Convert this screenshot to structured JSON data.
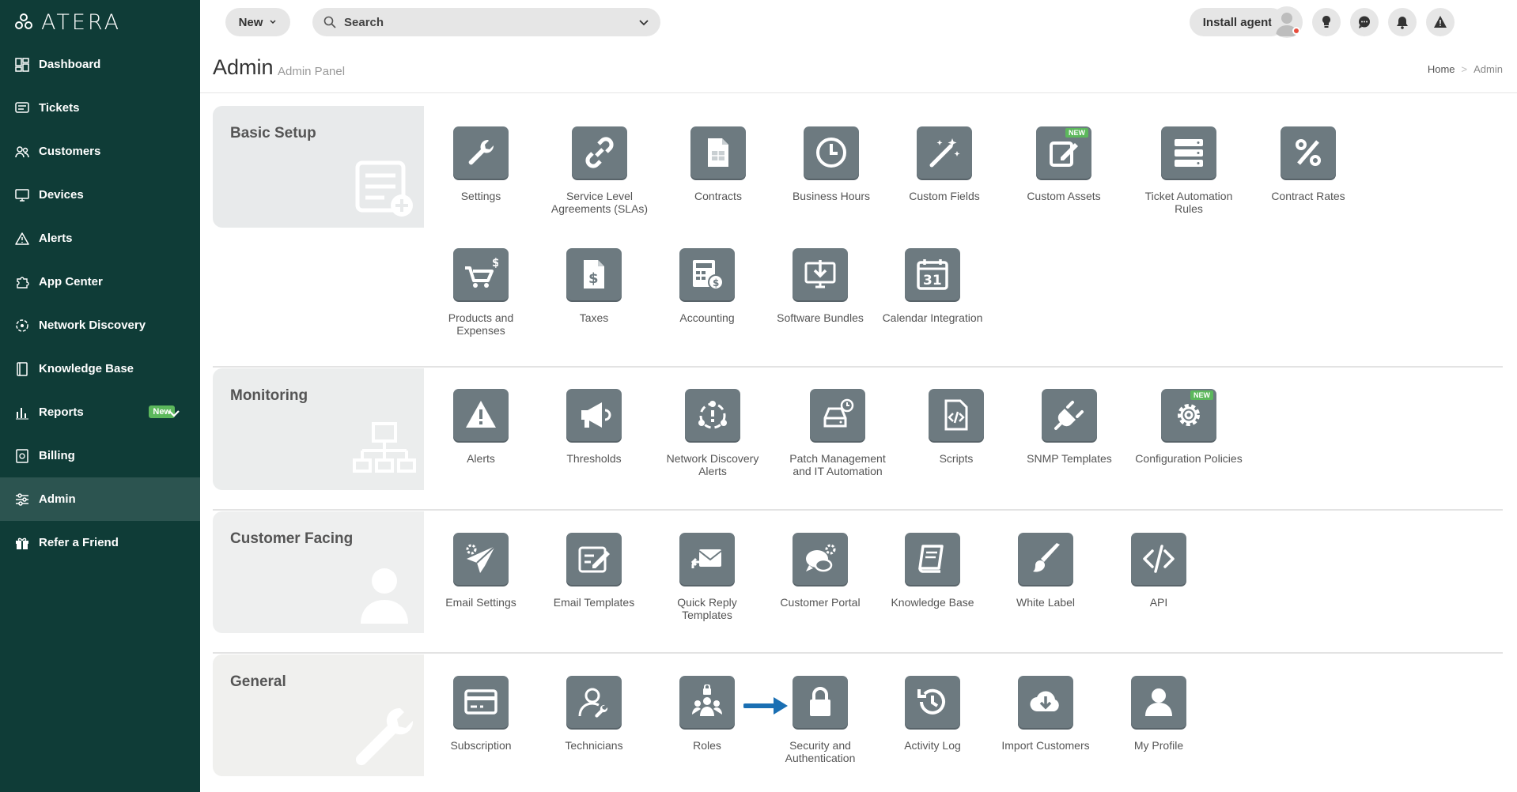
{
  "brand": {
    "name": "ATERA"
  },
  "sidebar": {
    "items": [
      {
        "label": "Dashboard",
        "icon": "dashboard-icon"
      },
      {
        "label": "Tickets",
        "icon": "ticket-icon"
      },
      {
        "label": "Customers",
        "icon": "customers-icon"
      },
      {
        "label": "Devices",
        "icon": "monitor-icon"
      },
      {
        "label": "Alerts",
        "icon": "alert-icon"
      },
      {
        "label": "App Center",
        "icon": "puzzle-icon"
      },
      {
        "label": "Network Discovery",
        "icon": "network-icon"
      },
      {
        "label": "Knowledge Base",
        "icon": "book-icon"
      },
      {
        "label": "Reports",
        "icon": "chart-icon",
        "badge": "New"
      },
      {
        "label": "Billing",
        "icon": "billing-icon"
      },
      {
        "label": "Admin",
        "icon": "sliders-icon",
        "active": true
      },
      {
        "label": "Refer a Friend",
        "icon": "gift-icon"
      }
    ]
  },
  "topbar": {
    "new_label": "New",
    "search_placeholder": "Search",
    "install_label": "Install agent"
  },
  "header": {
    "title": "Admin",
    "subtitle": "Admin Panel",
    "breadcrumb": [
      "Home",
      "Admin"
    ]
  },
  "sections": [
    {
      "title": "Basic Setup",
      "tiles": [
        {
          "label": "Settings",
          "icon": "wrench-icon"
        },
        {
          "label": "Service Level Agreements (SLAs)",
          "icon": "link-icon"
        },
        {
          "label": "Contracts",
          "icon": "contract-icon"
        },
        {
          "label": "Business Hours",
          "icon": "clock-icon"
        },
        {
          "label": "Custom Fields",
          "icon": "magic-wand-icon"
        },
        {
          "label": "Custom Assets",
          "icon": "edit-icon",
          "badge": "NEW"
        },
        {
          "label": "Ticket Automation Rules",
          "icon": "server-icon"
        },
        {
          "label": "Contract Rates",
          "icon": "percent-icon"
        },
        {
          "label": "Products and Expenses",
          "icon": "cart-icon"
        },
        {
          "label": "Taxes",
          "icon": "tax-document-icon"
        },
        {
          "label": "Accounting",
          "icon": "calculator-icon"
        },
        {
          "label": "Software Bundles",
          "icon": "download-icon"
        },
        {
          "label": "Calendar Integration",
          "icon": "calendar-icon",
          "day": "31"
        }
      ]
    },
    {
      "title": "Monitoring",
      "tiles": [
        {
          "label": "Alerts",
          "icon": "warning-icon"
        },
        {
          "label": "Thresholds",
          "icon": "megaphone-icon"
        },
        {
          "label": "Network Discovery Alerts",
          "icon": "network-discovery-icon"
        },
        {
          "label": "Patch Management and IT Automation",
          "icon": "patch-icon"
        },
        {
          "label": "Scripts",
          "icon": "code-file-icon"
        },
        {
          "label": "SNMP Templates",
          "icon": "plug-icon"
        },
        {
          "label": "Configuration Policies",
          "icon": "gear-icon",
          "badge": "NEW"
        }
      ]
    },
    {
      "title": "Customer Facing",
      "tiles": [
        {
          "label": "Email Settings",
          "icon": "send-gear-icon"
        },
        {
          "label": "Email Templates",
          "icon": "template-icon"
        },
        {
          "label": "Quick Reply Templates",
          "icon": "reply-mail-icon"
        },
        {
          "label": "Customer Portal",
          "icon": "chat-gear-icon"
        },
        {
          "label": "Knowledge Base",
          "icon": "book-icon"
        },
        {
          "label": "White Label",
          "icon": "brush-icon"
        },
        {
          "label": "API",
          "icon": "code-icon"
        }
      ]
    },
    {
      "title": "General",
      "tiles": [
        {
          "label": "Subscription",
          "icon": "credit-card-icon"
        },
        {
          "label": "Technicians",
          "icon": "technician-icon"
        },
        {
          "label": "Roles",
          "icon": "roles-icon"
        },
        {
          "label": "Security and Authentication",
          "icon": "lock-icon"
        },
        {
          "label": "Activity Log",
          "icon": "history-icon"
        },
        {
          "label": "Import Customers",
          "icon": "cloud-download-icon"
        },
        {
          "label": "My Profile",
          "icon": "user-icon"
        }
      ]
    }
  ],
  "colors": {
    "sidebar_bg": "#0f3c37",
    "sidebar_active": "#2c5450",
    "tile_bg": "#6d7a80",
    "new_badge": "#5cb85c",
    "arrow": "#1a6fb3"
  }
}
